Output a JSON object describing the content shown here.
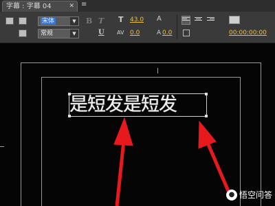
{
  "tab": {
    "title": "字幕 : 字幕 04",
    "close": "✕",
    "menu": "≡"
  },
  "toolbar": {
    "font_family": "宋体",
    "font_style": "常规",
    "bold": "B",
    "italic": "T",
    "underline": "U",
    "font_size": "43.0",
    "kerning": "0.0",
    "leading": "0.0",
    "timecode": "00:00:00:00"
  },
  "title": {
    "text": "是短发是短发"
  },
  "watermark": {
    "text": "悟空问答"
  },
  "colors": {
    "arrow": "#e8191c",
    "value": "#f0c040"
  }
}
